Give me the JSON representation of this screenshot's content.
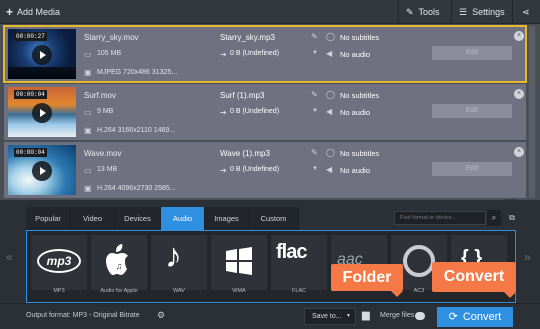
{
  "toolbar": {
    "add_media": "Add Media",
    "tools": "Tools",
    "settings": "Settings"
  },
  "files": [
    {
      "duration": "00:00:27",
      "name": "Starry_sky.mov",
      "size": "105 MB",
      "codec": "MJPEG 720x486 31325...",
      "output_name": "Starry_sky.mp3",
      "output_size": "0 B (Undefined)",
      "subtitles": "No subtitles",
      "audio": "No audio",
      "edit": "Edit",
      "selected": true
    },
    {
      "duration": "00:00:04",
      "name": "Surf.mov",
      "size": "9 MB",
      "codec": "H.264 3166x2110 1469...",
      "output_name": "Surf (1).mp3",
      "output_size": "0 B (Undefined)",
      "subtitles": "No subtitles",
      "audio": "No audio",
      "edit": "Edit",
      "selected": false
    },
    {
      "duration": "00:00:04",
      "name": "Wave.mov",
      "size": "13 MB",
      "codec": "H.264 4096x2730 2585...",
      "output_name": "Wave (1).mp3",
      "output_size": "0 B (Undefined)",
      "subtitles": "No subtitles",
      "audio": "No audio",
      "edit": "Edit",
      "selected": false
    }
  ],
  "tabs": [
    "Popular",
    "Video",
    "Devices",
    "Audio",
    "Images",
    "Custom"
  ],
  "active_tab": "Audio",
  "search": {
    "placeholder": "Find format or device..."
  },
  "formats": [
    {
      "label": "MP3",
      "glyph": "mp3"
    },
    {
      "label": "Audio for Apple",
      "glyph": ""
    },
    {
      "label": "WAV",
      "glyph": "♪"
    },
    {
      "label": "WMA",
      "glyph": ""
    },
    {
      "label": "FLAC",
      "glyph": "flac"
    },
    {
      "label": "",
      "glyph": "aac"
    },
    {
      "label": "AC3",
      "glyph": ""
    },
    {
      "label": "",
      "glyph": "{ }"
    }
  ],
  "bottom": {
    "output_format": "Output format: MP3 - Original Bitrate",
    "save_to": "Save to...",
    "merge_files": "Merge files",
    "convert": "Convert"
  },
  "callouts": {
    "folder": "Folder",
    "convert": "Convert"
  },
  "colors": {
    "accent": "#2f8fe0",
    "selection": "#e7b72c",
    "callout": "#f57847"
  }
}
